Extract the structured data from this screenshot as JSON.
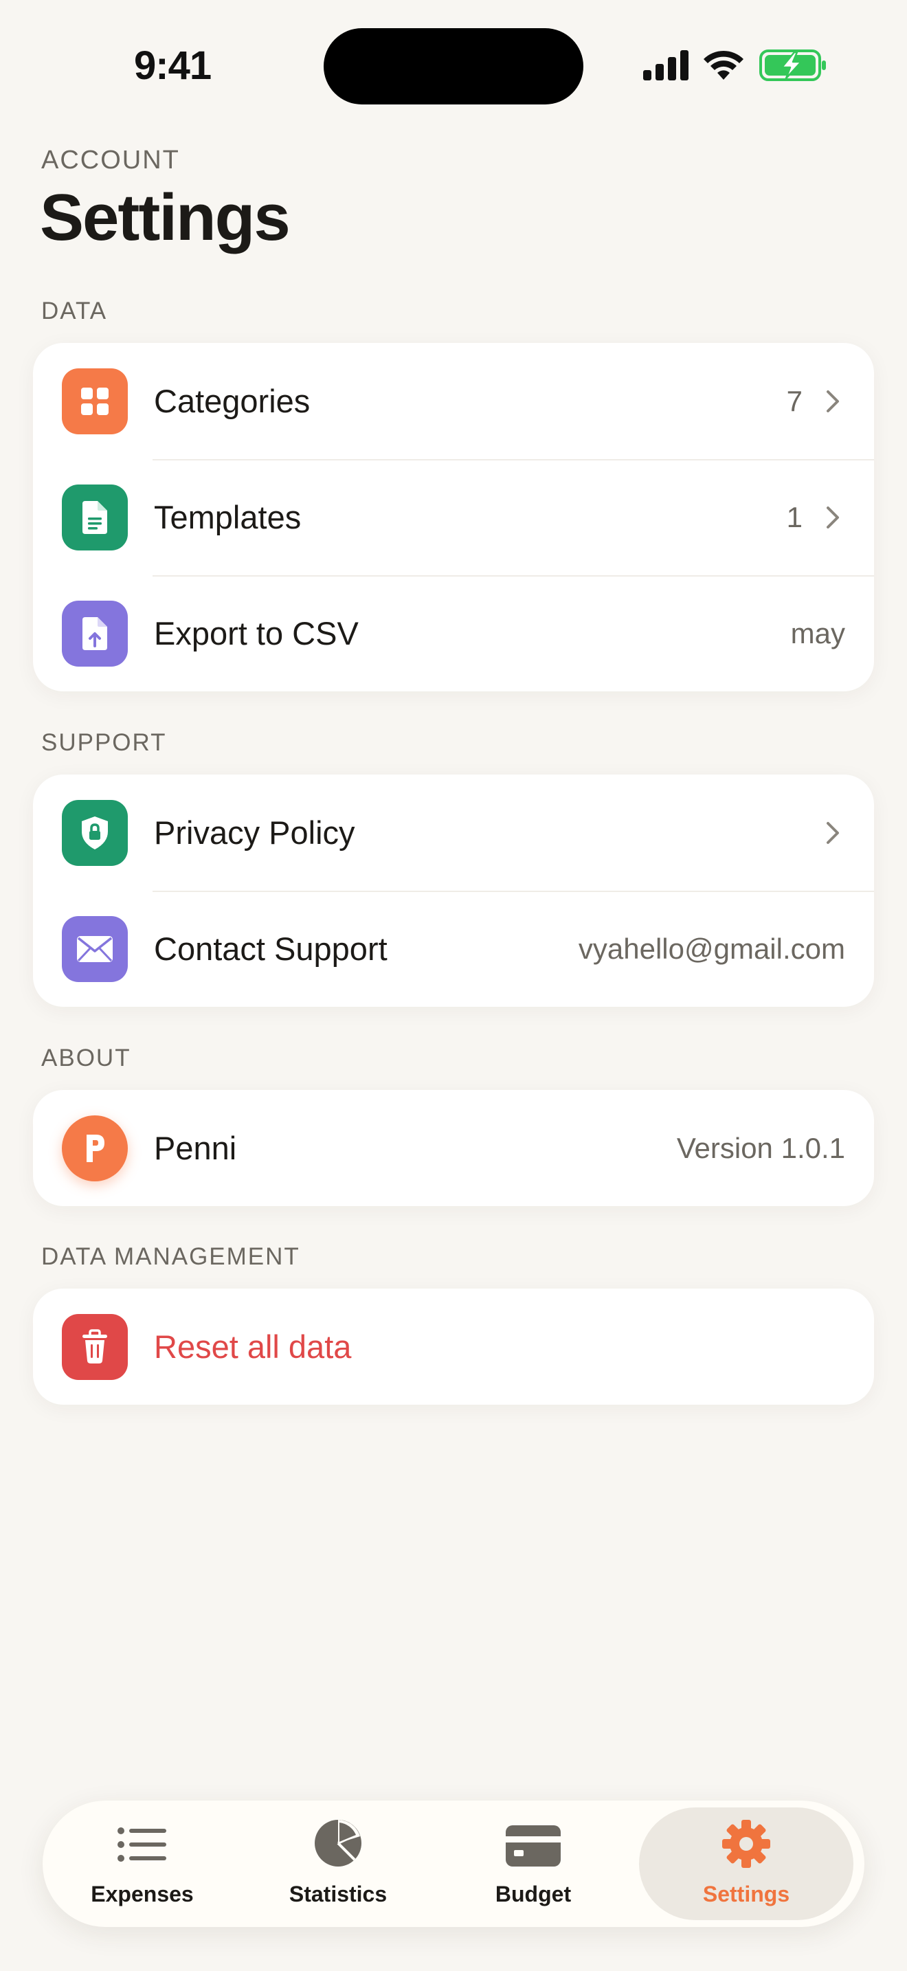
{
  "status_bar": {
    "time": "9:41"
  },
  "header": {
    "eyebrow": "ACCOUNT",
    "title": "Settings"
  },
  "sections": {
    "data": {
      "label": "DATA",
      "rows": [
        {
          "label": "Categories",
          "value": "7",
          "icon": "grid-icon",
          "color": "#f57a48"
        },
        {
          "label": "Templates",
          "value": "1",
          "icon": "document-icon",
          "color": "#1f9a6c"
        },
        {
          "label": "Export to CSV",
          "value": "may",
          "icon": "file-export-icon",
          "color": "#8475dd"
        }
      ]
    },
    "support": {
      "label": "SUPPORT",
      "rows": [
        {
          "label": "Privacy Policy",
          "icon": "shield-lock-icon",
          "color": "#1f9a6c"
        },
        {
          "label": "Contact Support",
          "value": "vyahello@gmail.com",
          "icon": "envelope-icon",
          "color": "#8475dd"
        }
      ]
    },
    "about": {
      "label": "ABOUT",
      "rows": [
        {
          "label": "Penni",
          "value": "Version 1.0.1",
          "icon": "app-logo-icon",
          "color": "#f57a48"
        }
      ]
    },
    "data_management": {
      "label": "DATA MANAGEMENT",
      "rows": [
        {
          "label": "Reset all data",
          "icon": "trash-icon",
          "color": "#e04848"
        }
      ]
    }
  },
  "tab_bar": {
    "tabs": [
      {
        "label": "Expenses",
        "icon": "list-icon",
        "active": false
      },
      {
        "label": "Statistics",
        "icon": "pie-chart-icon",
        "active": false
      },
      {
        "label": "Budget",
        "icon": "wallet-card-icon",
        "active": false
      },
      {
        "label": "Settings",
        "icon": "gear-icon",
        "active": true
      }
    ]
  },
  "colors": {
    "background": "#f8f6f2",
    "accent": "#f0743e",
    "danger": "#e04848",
    "battery": "#34c759"
  }
}
